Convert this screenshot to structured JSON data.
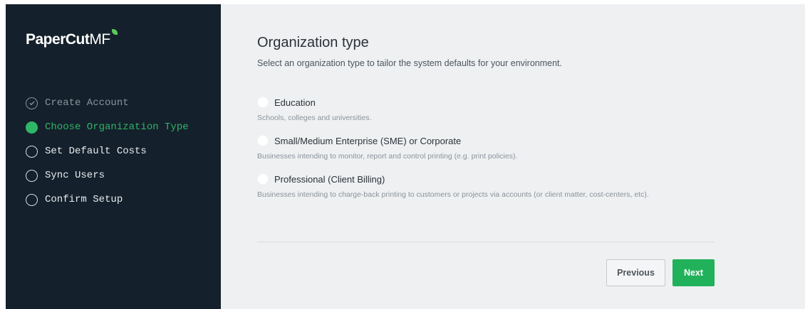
{
  "brand": {
    "name_part1": "PaperCut",
    "name_part2": "MF",
    "accent_color": "#2fb567"
  },
  "sidebar": {
    "steps": [
      {
        "label": "Create Account",
        "state": "done"
      },
      {
        "label": "Choose Organization Type",
        "state": "active"
      },
      {
        "label": "Set Default Costs",
        "state": "pending"
      },
      {
        "label": "Sync Users",
        "state": "pending"
      },
      {
        "label": "Confirm Setup",
        "state": "pending"
      }
    ]
  },
  "main": {
    "title": "Organization type",
    "subtitle": "Select an organization type to tailor the system defaults for your environment.",
    "options": [
      {
        "label": "Education",
        "description": "Schools, colleges and universities.",
        "selected": false
      },
      {
        "label": "Small/Medium Enterprise (SME) or Corporate",
        "description": "Businesses intending to monitor, report and control printing (e.g. print policies).",
        "selected": false
      },
      {
        "label": "Professional (Client Billing)",
        "description": "Businesses intending to charge-back printing to customers or projects via accounts (or client matter, cost-centers, etc).",
        "selected": false
      }
    ]
  },
  "footer": {
    "previous_label": "Previous",
    "next_label": "Next"
  }
}
